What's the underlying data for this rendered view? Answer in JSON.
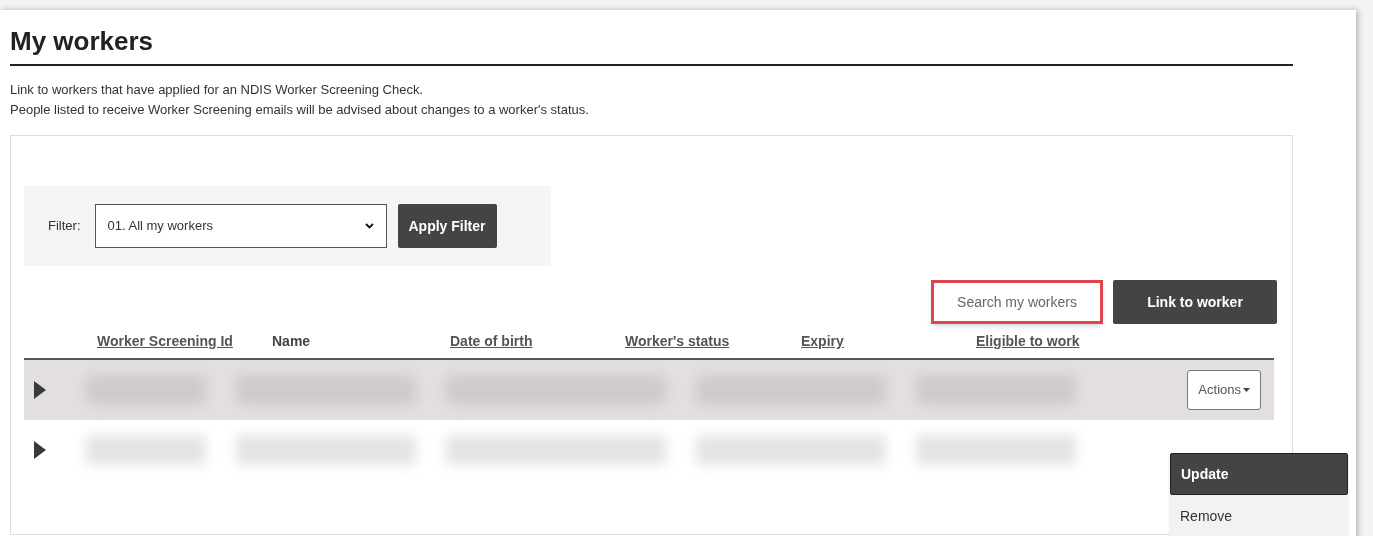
{
  "page": {
    "title": "My workers",
    "intro": [
      "Link to workers that have applied for an NDIS Worker Screening Check.",
      "People listed to receive Worker Screening emails will be advised about changes to a worker's status."
    ]
  },
  "filter": {
    "label": "Filter:",
    "value": "01. All my workers",
    "button": "Apply Filter"
  },
  "search": {
    "placeholder": "Search my workers",
    "highlighted": true
  },
  "link_button": "Link to worker",
  "table": {
    "columns": [
      {
        "label": "Worker Screening Id",
        "sortable": true
      },
      {
        "label": "Name",
        "sortable": false
      },
      {
        "label": "Date of birth",
        "sortable": true
      },
      {
        "label": "Worker's status",
        "sortable": true
      },
      {
        "label": "Expiry",
        "sortable": true
      },
      {
        "label": "Eligible to work",
        "sortable": true
      }
    ],
    "rows": [
      {
        "highlighted": true,
        "expanded": false,
        "actions": "Actions"
      },
      {
        "highlighted": false,
        "expanded": false
      }
    ]
  },
  "actions_menu": [
    {
      "label": "Update",
      "selected": true
    },
    {
      "label": "Remove",
      "selected": false
    }
  ]
}
